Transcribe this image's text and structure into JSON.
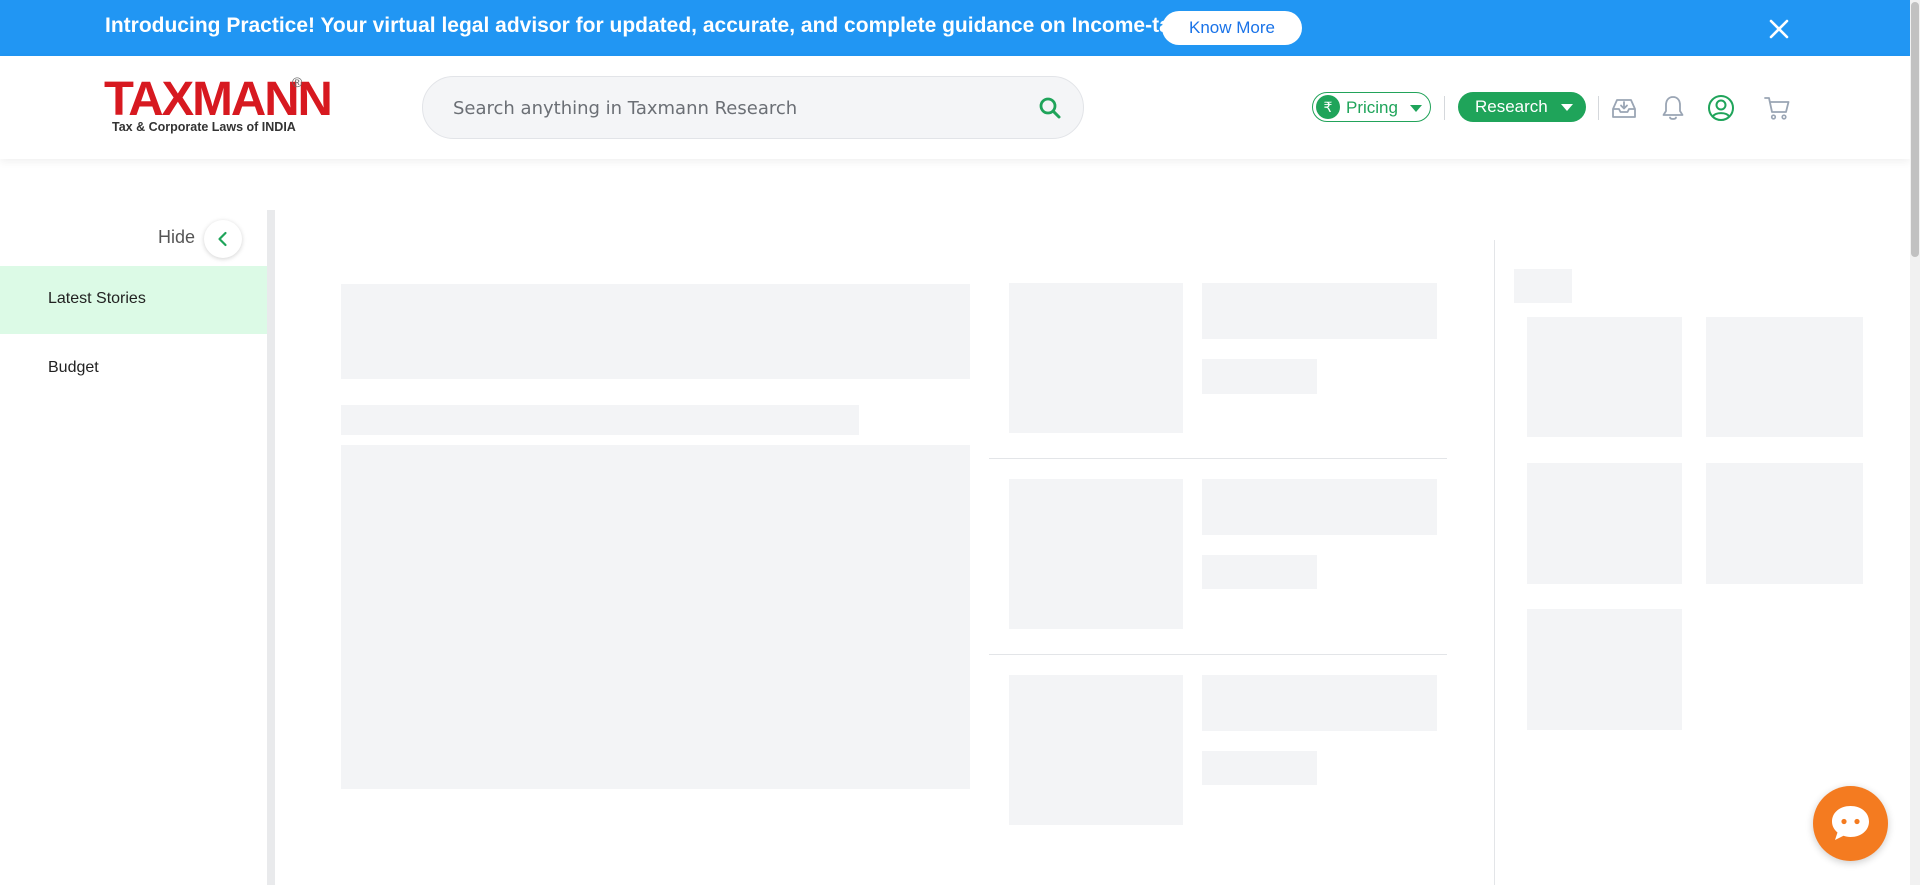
{
  "banner": {
    "text": "Introducing Practice! Your virtual legal advisor for updated, accurate, and complete guidance on Income-tax.",
    "cta_label": "Know More",
    "color": "#2196f3"
  },
  "header": {
    "logo": {
      "brand": "TAXMANN",
      "registered": "®",
      "tagline": "Tax & Corporate Laws of INDIA"
    },
    "search": {
      "placeholder": "Search anything in Taxmann Research"
    },
    "pricing": {
      "currency_symbol": "₹",
      "label": "Pricing"
    },
    "research": {
      "label": "Research"
    },
    "icons": [
      "download-tray-icon",
      "bell-icon",
      "user-icon",
      "cart-icon"
    ],
    "accent_color": "#1fa45a"
  },
  "sidebar": {
    "hide_label": "Hide",
    "items": [
      {
        "label": "Latest Stories",
        "active": true
      },
      {
        "label": "Budget",
        "active": false
      }
    ]
  }
}
